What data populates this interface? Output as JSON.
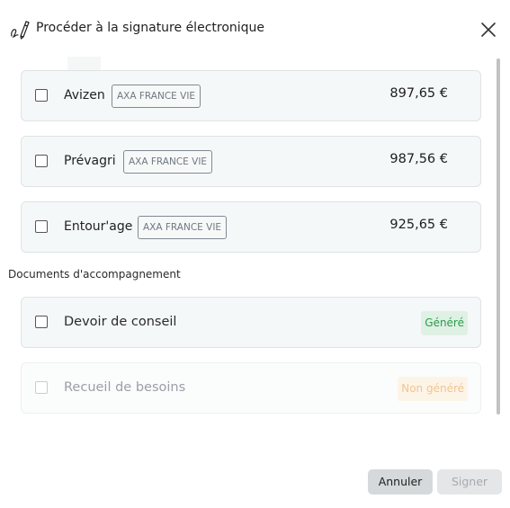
{
  "header": {
    "title": "Procéder à la signature électronique",
    "signature_icon": "signature-pen-icon",
    "close_icon": "close-icon"
  },
  "products": [
    {
      "name": "Avizen",
      "insurer": "AXA FRANCE VIE",
      "price": "897,65 €",
      "checked": false
    },
    {
      "name": "Prévagri",
      "insurer": "AXA FRANCE VIE",
      "price": "987,56 €",
      "checked": false
    },
    {
      "name": "Entour'age",
      "insurer": "AXA FRANCE VIE",
      "price": "925,65 €",
      "checked": false
    }
  ],
  "documents": {
    "section_label": "Documents d'accompagnement",
    "items": [
      {
        "name": "Devoir de conseil",
        "status": "Généré",
        "enabled": true,
        "checked": false
      },
      {
        "name": "Recueil de besoins",
        "status": "Non généré",
        "enabled": false,
        "checked": false
      }
    ]
  },
  "footer": {
    "cancel_label": "Annuler",
    "sign_label": "Signer"
  },
  "colors": {
    "generated_text": "#2d9b4c",
    "generated_bg": "#dff1e4",
    "not_generated_text": "#f2c58f",
    "not_generated_bg": "#fdf4e8"
  }
}
